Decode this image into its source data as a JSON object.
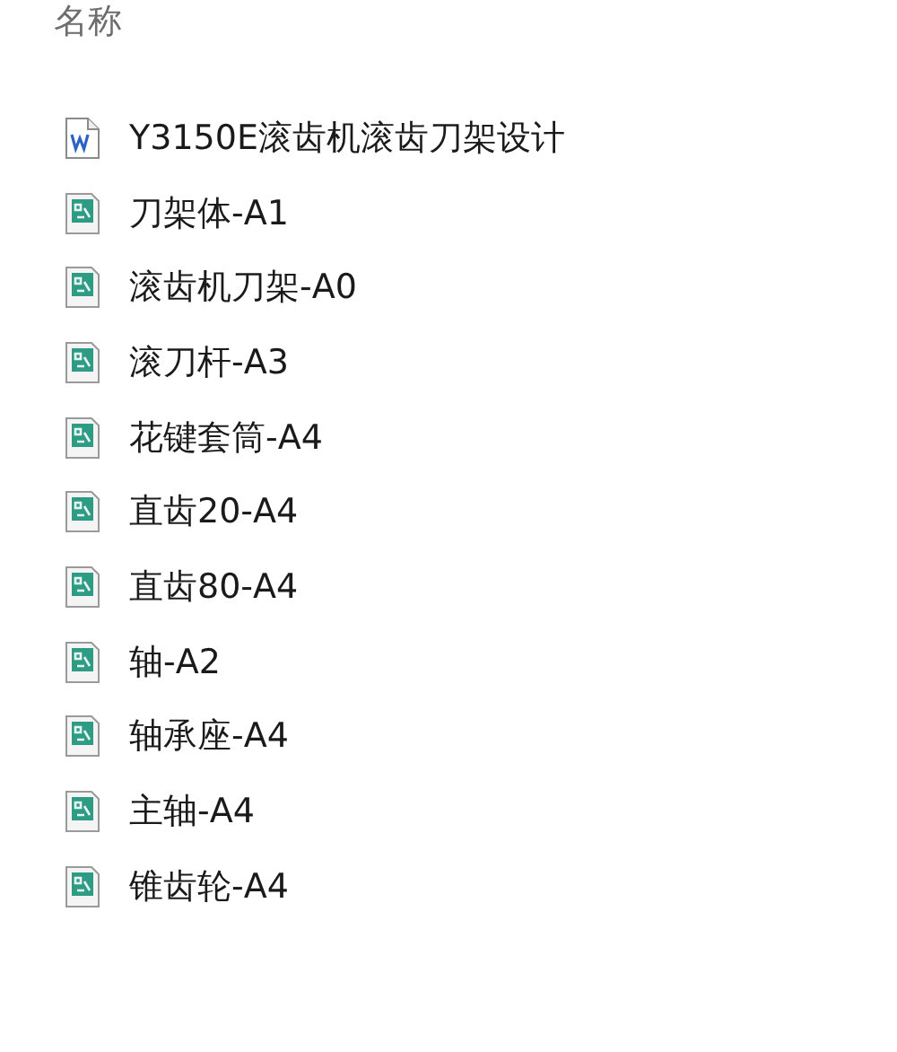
{
  "header": {
    "label": "名称"
  },
  "files": [
    {
      "name": "Y3150E滚齿机滚齿刀架设计",
      "kind": "word"
    },
    {
      "name": "刀架体-A1",
      "kind": "cad"
    },
    {
      "name": "滚齿机刀架-A0",
      "kind": "cad"
    },
    {
      "name": "滚刀杆-A3",
      "kind": "cad"
    },
    {
      "name": "花键套筒-A4",
      "kind": "cad"
    },
    {
      "name": "直齿20-A4",
      "kind": "cad"
    },
    {
      "name": "直齿80-A4",
      "kind": "cad"
    },
    {
      "name": "轴-A2",
      "kind": "cad"
    },
    {
      "name": "轴承座-A4",
      "kind": "cad"
    },
    {
      "name": "主轴-A4",
      "kind": "cad"
    },
    {
      "name": "锥齿轮-A4",
      "kind": "cad"
    }
  ]
}
